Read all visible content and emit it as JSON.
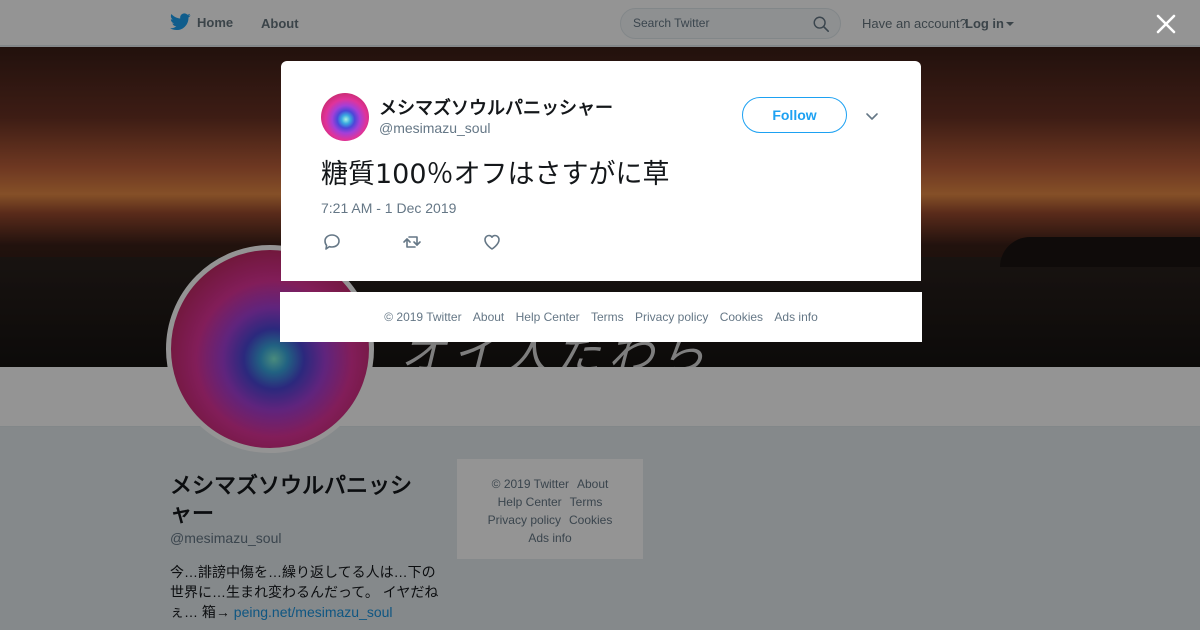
{
  "nav": {
    "home_label": "Home",
    "about_label": "About",
    "search_placeholder": "Search Twitter",
    "have_account": "Have an account?",
    "login_label": "Log in"
  },
  "banner": {
    "overlay_text": "オイ人だわら"
  },
  "profile": {
    "name": "メシマズソウルパニッシャー",
    "handle": "@mesimazu_soul",
    "bio_text": "今…誹謗中傷を…繰り返してる人は…下の世界に…生まれ変わるんだって。 イヤだねぇ… 箱→ ",
    "bio_link": "peing.net/mesimazu_soul"
  },
  "side_footer": {
    "copyright": "© 2019 Twitter",
    "about": "About",
    "help": "Help Center",
    "terms": "Terms",
    "privacy": "Privacy policy",
    "cookies": "Cookies",
    "ads": "Ads info"
  },
  "tweet": {
    "author_name": "メシマズソウルパニッシャー",
    "author_handle": "@mesimazu_soul",
    "follow_label": "Follow",
    "text": "糖質100％オフはさすがに草",
    "timestamp": "7:21 AM - 1 Dec 2019"
  },
  "modal_footer": {
    "copyright": "© 2019 Twitter",
    "about": "About",
    "help": "Help Center",
    "terms": "Terms",
    "privacy": "Privacy policy",
    "cookies": "Cookies",
    "ads": "Ads info"
  },
  "colors": {
    "accent": "#1da1f2",
    "overlay": "rgba(0,0,0,0.42)",
    "text_secondary": "#657786"
  },
  "icons": [
    "twitter-bird-icon",
    "search-icon",
    "caret-down-icon",
    "close-icon",
    "chevron-down-icon",
    "reply-icon",
    "retweet-icon",
    "like-icon"
  ]
}
